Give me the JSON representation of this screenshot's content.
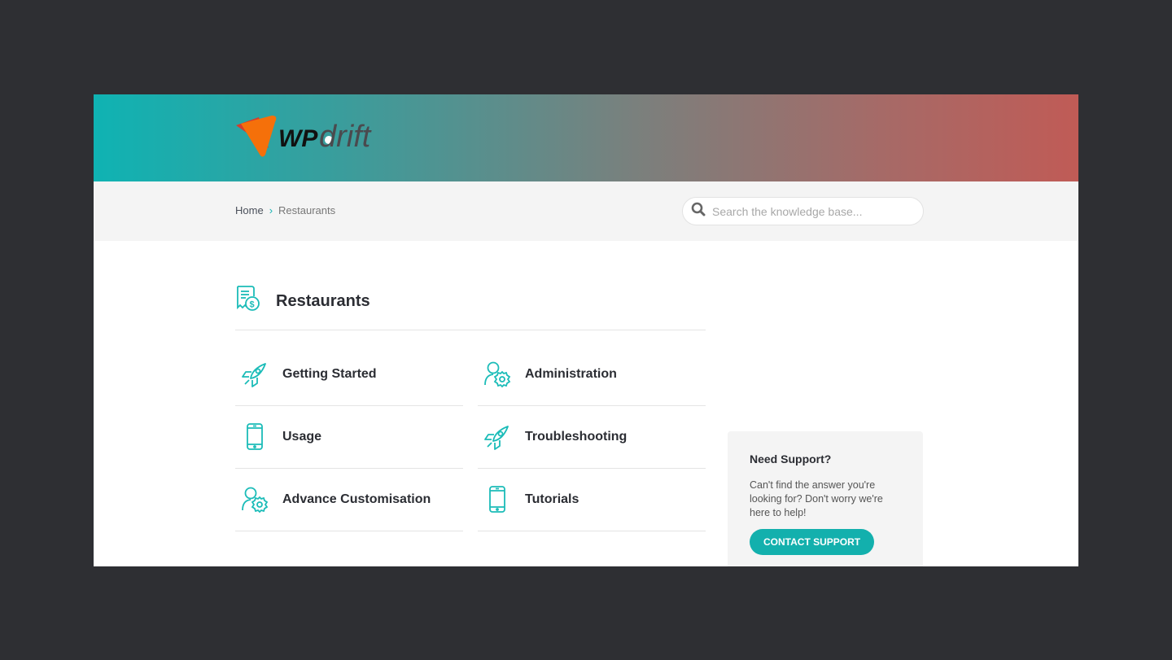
{
  "brand": {
    "logo_text_a": "WP",
    "logo_text_b": "drift",
    "accent_color": "#13b0ad"
  },
  "breadcrumb": {
    "items": [
      "Home",
      "Restaurants"
    ],
    "separator": "›"
  },
  "search": {
    "placeholder": "Search the knowledge base...",
    "value": ""
  },
  "category": {
    "title": "Restaurants",
    "icon": "receipt-dollar-icon"
  },
  "sections": [
    {
      "label": "Getting Started",
      "icon": "rocket-icon"
    },
    {
      "label": "Administration",
      "icon": "user-gear-icon"
    },
    {
      "label": "Usage",
      "icon": "smartphone-icon"
    },
    {
      "label": "Troubleshooting",
      "icon": "rocket-icon"
    },
    {
      "label": "Advance Customisation",
      "icon": "user-gear-icon"
    },
    {
      "label": "Tutorials",
      "icon": "smartphone-icon"
    }
  ],
  "support": {
    "title": "Need Support?",
    "text": "Can't find the answer you're looking for? Don't worry we're here to help!",
    "button": "CONTACT SUPPORT"
  }
}
